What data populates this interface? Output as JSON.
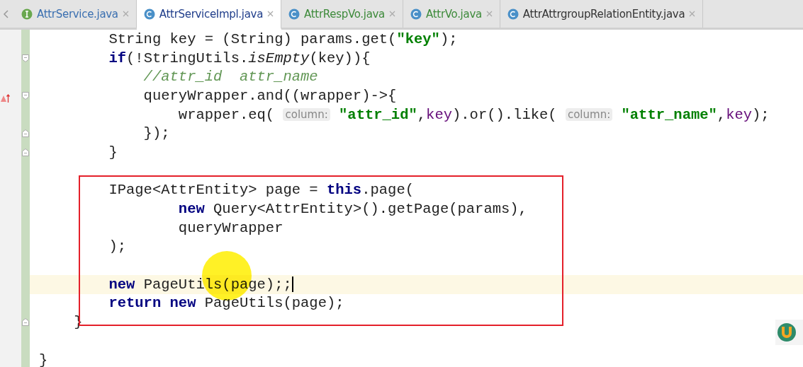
{
  "tabs": [
    {
      "label": "AttrService.java",
      "kind": "interface",
      "color": "#3a6fb0",
      "selected": false
    },
    {
      "label": "AttrServiceImpl.java",
      "kind": "class",
      "color": "#1f3d8a",
      "selected": true
    },
    {
      "label": "AttrRespVo.java",
      "kind": "class",
      "color": "#3d8a3a",
      "selected": false
    },
    {
      "label": "AttrVo.java",
      "kind": "class",
      "color": "#3d8a3a",
      "selected": false
    },
    {
      "label": "AttrAttrgroupRelationEntity.java",
      "kind": "class",
      "color": "#333333",
      "selected": false
    }
  ],
  "lines": [
    {
      "tokens": [
        {
          "kind": "plain",
          "text": "        String key = (String) params.get("
        },
        {
          "kind": "string",
          "text": "\"key\""
        },
        {
          "kind": "plain",
          "text": ");"
        }
      ]
    },
    {
      "kind": "fold-start",
      "tokens": [
        {
          "kind": "keyword",
          "text": "        if"
        },
        {
          "kind": "plain",
          "text": "(!StringUtils."
        },
        {
          "kind": "italic",
          "text": "isEmpty"
        },
        {
          "kind": "plain",
          "text": "(key)){"
        }
      ]
    },
    {
      "tokens": [
        {
          "kind": "comment",
          "text": "            //attr_id  attr_name"
        }
      ]
    },
    {
      "kind": "fold-start",
      "tokens": [
        {
          "kind": "plain",
          "text": "            queryWrapper.and((wrapper)->{"
        }
      ]
    },
    {
      "tokens": [
        {
          "kind": "plain",
          "text": "                wrapper.eq( "
        },
        {
          "kind": "hint",
          "text": "column:"
        },
        {
          "kind": "string",
          "text": " \"attr_id\""
        },
        {
          "kind": "plain",
          "text": ","
        },
        {
          "kind": "param",
          "text": "key"
        },
        {
          "kind": "plain",
          "text": ").or().like( "
        },
        {
          "kind": "hint",
          "text": "column:"
        },
        {
          "kind": "string",
          "text": " \"attr_name\""
        },
        {
          "kind": "plain",
          "text": ","
        },
        {
          "kind": "param",
          "text": "key"
        },
        {
          "kind": "plain",
          "text": ");"
        }
      ]
    },
    {
      "kind": "fold-end",
      "tokens": [
        {
          "kind": "plain",
          "text": "            });"
        }
      ]
    },
    {
      "kind": "fold-end",
      "tokens": [
        {
          "kind": "plain",
          "text": "        }"
        }
      ]
    },
    {
      "kind": "blank"
    },
    {
      "tokens": [
        {
          "kind": "plain",
          "text": "        IPage<AttrEntity> page = "
        },
        {
          "kind": "keyword",
          "text": "this"
        },
        {
          "kind": "plain",
          "text": ".page("
        }
      ]
    },
    {
      "tokens": [
        {
          "kind": "keyword",
          "text": "                new"
        },
        {
          "kind": "plain",
          "text": " Query<AttrEntity>().getPage(params),"
        }
      ]
    },
    {
      "tokens": [
        {
          "kind": "plain",
          "text": "                queryWrapper"
        }
      ]
    },
    {
      "tokens": [
        {
          "kind": "plain",
          "text": "        );"
        }
      ]
    },
    {
      "kind": "blank"
    },
    {
      "current": true,
      "caret": true,
      "tokens": [
        {
          "kind": "keyword",
          "text": "        new"
        },
        {
          "kind": "plain",
          "text": " PageUtils(page);;"
        }
      ]
    },
    {
      "tokens": [
        {
          "kind": "keyword",
          "text": "        return new"
        },
        {
          "kind": "plain",
          "text": " PageUtils(page);"
        }
      ]
    },
    {
      "kind": "fold-end",
      "tokens": [
        {
          "kind": "plain",
          "text": "    }"
        }
      ]
    },
    {
      "kind": "blank"
    },
    {
      "tokens": [
        {
          "kind": "plain",
          "text": "}"
        }
      ]
    }
  ]
}
